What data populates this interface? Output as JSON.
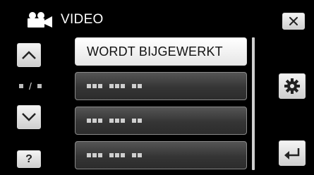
{
  "header": {
    "title": "VIDEO",
    "icon": "video-camera-icon"
  },
  "menu": {
    "items": [
      {
        "label": "WORDT BIJGEWERKT",
        "selected": true
      },
      {
        "label": "",
        "placeholder_dots": true
      },
      {
        "label": "",
        "placeholder_dots": true
      },
      {
        "label": "",
        "placeholder_dots": true
      }
    ]
  },
  "page_indicator": {
    "separator": "/"
  },
  "buttons": {
    "close": "close-icon",
    "up": "up-arrow-icon",
    "down": "down-arrow-icon",
    "help": "?",
    "settings": "gear-icon",
    "back": "return-icon"
  },
  "colors": {
    "background": "#000000",
    "selected_item": "#ffffff",
    "item": "#3a3a3a"
  }
}
